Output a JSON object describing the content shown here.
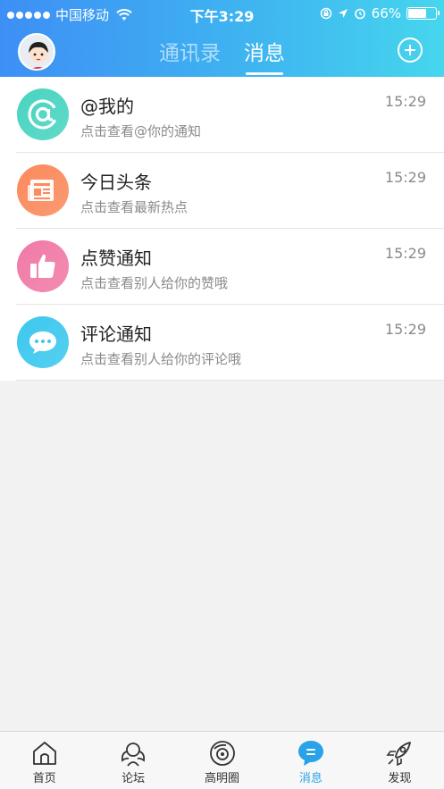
{
  "status_bar": {
    "carrier": "中国移动",
    "time": "下午3:29",
    "battery": "66%",
    "battery_level": 0.66
  },
  "header": {
    "tabs": [
      {
        "label": "通讯录",
        "active": false
      },
      {
        "label": "消息",
        "active": true
      }
    ]
  },
  "messages": [
    {
      "title": "@我的",
      "subtitle": "点击查看@你的通知",
      "time": "15:29",
      "icon": "at-icon",
      "color": "#48d4c0"
    },
    {
      "title": "今日头条",
      "subtitle": "点击查看最新热点",
      "time": "15:29",
      "icon": "newspaper-icon",
      "color": "#fb8a5c"
    },
    {
      "title": "点赞通知",
      "subtitle": "点击查看别人给你的赞哦",
      "time": "15:29",
      "icon": "thumbs-up-icon",
      "color": "#f07aa6"
    },
    {
      "title": "评论通知",
      "subtitle": "点击查看别人给你的评论哦",
      "time": "15:29",
      "icon": "comment-icon",
      "color": "#3cc8ee"
    }
  ],
  "tabbar": [
    {
      "label": "首页",
      "icon": "home-icon",
      "active": false
    },
    {
      "label": "论坛",
      "icon": "forum-icon",
      "active": false
    },
    {
      "label": "高明圈",
      "icon": "circle-icon",
      "active": false
    },
    {
      "label": "消息",
      "icon": "message-icon",
      "active": true
    },
    {
      "label": "发现",
      "icon": "rocket-icon",
      "active": false
    }
  ],
  "colors": {
    "accent": "#2aa2e8",
    "header_start": "#3d8ff5",
    "header_end": "#46d6ee"
  }
}
